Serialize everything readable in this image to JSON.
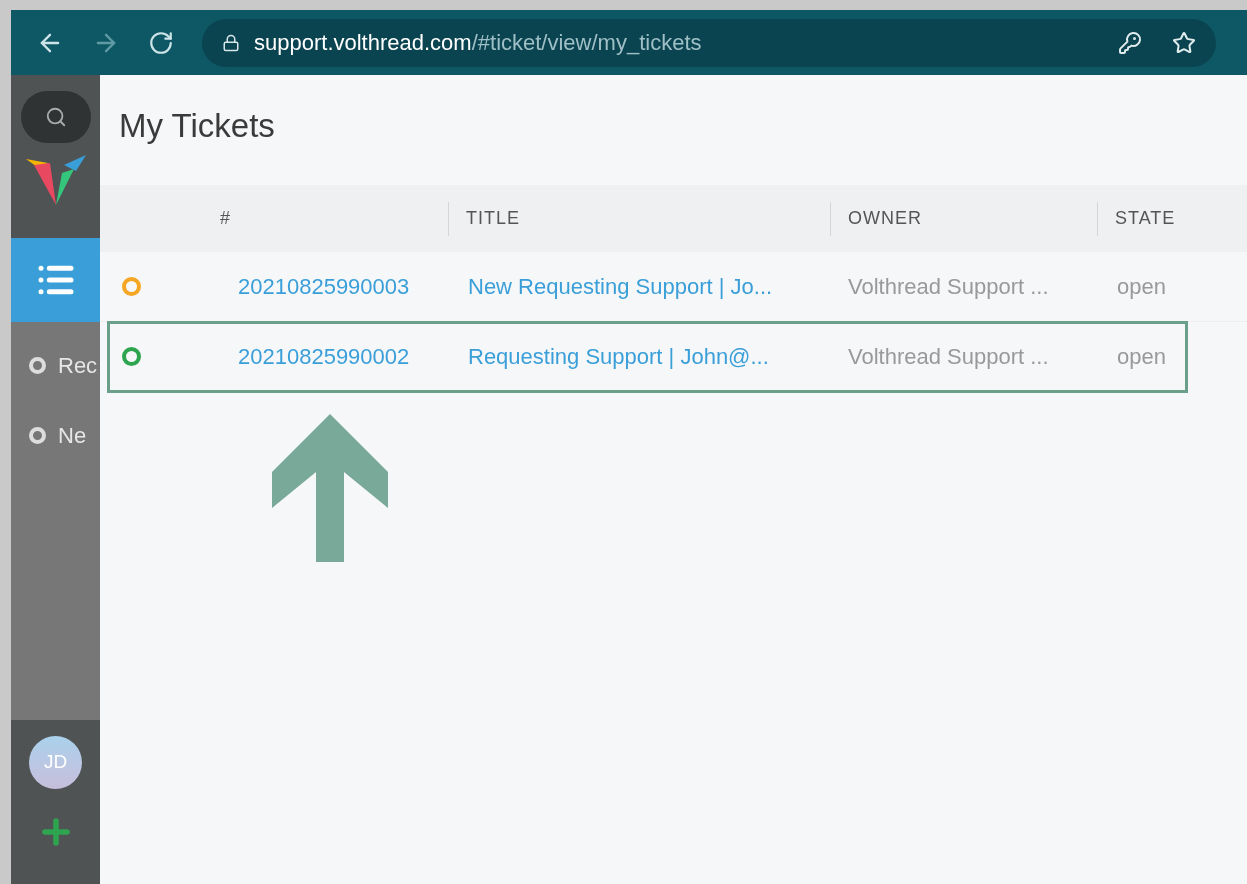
{
  "browser": {
    "url_host": "support.volthread.com",
    "url_path": "/#ticket/view/my_tickets"
  },
  "sidebar": {
    "items": [
      {
        "kind": "list",
        "selected": true
      }
    ],
    "overviews": [
      {
        "label": "Rec"
      },
      {
        "label": "Ne"
      }
    ],
    "avatar": "JD"
  },
  "page": {
    "title": "My Tickets"
  },
  "table": {
    "columns": [
      "#",
      "TITLE",
      "OWNER",
      "STATE"
    ],
    "rows": [
      {
        "color": "#f5a623",
        "number": "20210825990003",
        "title": "New Requesting Support | Jo...",
        "owner": "Volthread Support ...",
        "state": "open",
        "highlighted": false
      },
      {
        "color": "#2ea44f",
        "number": "20210825990002",
        "title": "Requesting Support | John@...",
        "owner": "Volthread Support ...",
        "state": "open",
        "highlighted": true
      }
    ]
  }
}
